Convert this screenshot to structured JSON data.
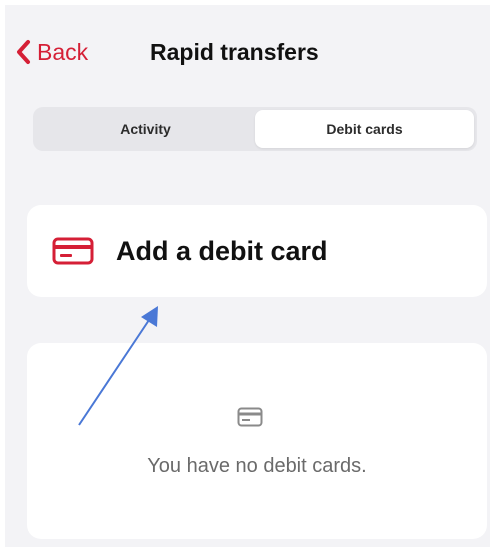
{
  "header": {
    "back_label": "Back",
    "title": "Rapid transfers"
  },
  "tabs": [
    {
      "label": "Activity",
      "selected": false
    },
    {
      "label": "Debit cards",
      "selected": true
    }
  ],
  "add_card": {
    "label": "Add a debit card",
    "icon": "credit-card-icon"
  },
  "empty_state": {
    "icon": "credit-card-icon",
    "message": "You have no debit cards."
  },
  "colors": {
    "accent": "#d51f36",
    "background": "#f3f3f6",
    "annotation_arrow": "#4a78d6"
  }
}
